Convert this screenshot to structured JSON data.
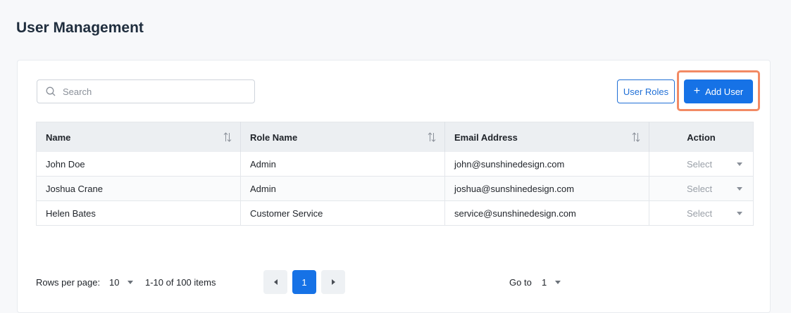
{
  "header": {
    "title": "User Management"
  },
  "toolbar": {
    "search_placeholder": "Search",
    "search_value": "",
    "user_roles_label": "User Roles",
    "add_user_label": "Add User"
  },
  "table": {
    "columns": [
      "Name",
      "Role Name",
      "Email Address",
      "Action"
    ],
    "rows": [
      {
        "name": "John Doe",
        "role": "Admin",
        "email": "john@sunshinedesign.com",
        "action": "Select"
      },
      {
        "name": "Joshua Crane",
        "role": "Admin",
        "email": "joshua@sunshinedesign.com",
        "action": "Select"
      },
      {
        "name": "Helen Bates",
        "role": "Customer Service",
        "email": "service@sunshinedesign.com",
        "action": "Select"
      }
    ]
  },
  "pagination": {
    "rows_per_page_label": "Rows per page:",
    "rows_per_page_value": "10",
    "range_text": "1-10 of 100 items",
    "current_page": "1",
    "goto_label": "Go to",
    "goto_value": "1"
  },
  "colors": {
    "primary": "#1672e6",
    "highlight": "#f28a64"
  }
}
